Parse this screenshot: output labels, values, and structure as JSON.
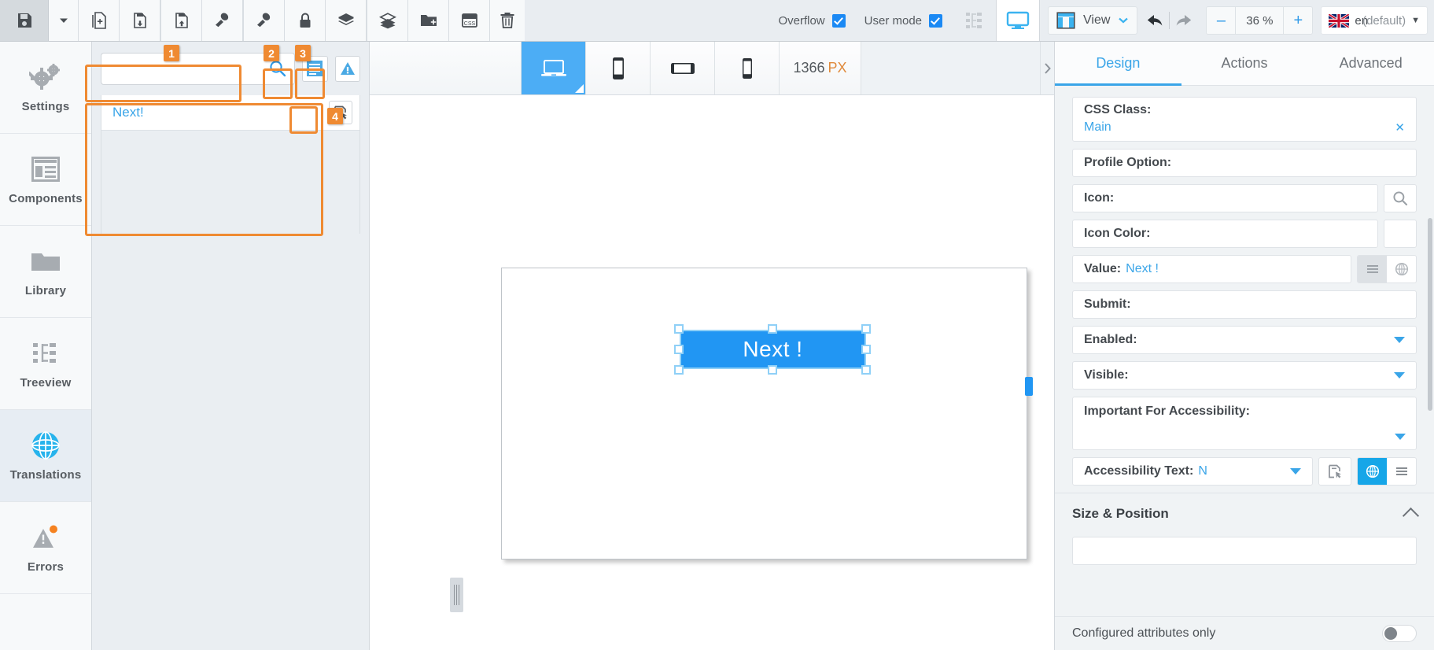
{
  "toolbar": {
    "buttons": [
      {
        "name": "save-button",
        "icon": "save-icon"
      },
      {
        "name": "save-dropdown-button",
        "icon": "caret-down-icon"
      },
      {
        "name": "new-page-button",
        "icon": "new-page-icon"
      },
      {
        "name": "import-button",
        "icon": "page-upload-icon"
      },
      {
        "name": "export-button",
        "icon": "page-download-icon"
      },
      {
        "name": "undo-paint-button",
        "icon": "paint-roller-icon"
      },
      {
        "name": "redo-paint-button",
        "icon": "paint-roller-alt-icon"
      },
      {
        "name": "lock-button",
        "icon": "lock-icon"
      },
      {
        "name": "layers-down-button",
        "icon": "layers-down-icon"
      },
      {
        "name": "layers-up-button",
        "icon": "layers-up-icon"
      },
      {
        "name": "new-folder-button",
        "icon": "folder-plus-icon"
      },
      {
        "name": "css-button",
        "icon": "css-icon"
      },
      {
        "name": "delete-button",
        "icon": "trash-icon"
      }
    ],
    "overflow_label": "Overflow",
    "overflow_checked": true,
    "user_mode_label": "User mode",
    "user_mode_checked": true,
    "tree_toggle_icon": "treeview-icon",
    "monitor_icon": "monitor-icon",
    "view_label": "View",
    "undo_icon": "undo-arrow-icon",
    "redo_icon": "redo-arrow-icon",
    "zoom_minus": "–",
    "zoom_value": "36 %",
    "zoom_plus": "+",
    "language_code": "en",
    "language_default": "(default)"
  },
  "rail": {
    "items": [
      {
        "label": "Settings",
        "icon": "gears-icon",
        "active": false
      },
      {
        "label": "Components",
        "icon": "components-icon",
        "active": false
      },
      {
        "label": "Library",
        "icon": "folder-icon",
        "active": false
      },
      {
        "label": "Treeview",
        "icon": "treeview-icon",
        "active": false
      },
      {
        "label": "Translations",
        "icon": "globe-icon",
        "active": true
      },
      {
        "label": "Errors",
        "icon": "warning-triangle-icon",
        "active": false
      }
    ]
  },
  "translations_panel": {
    "search_placeholder": "",
    "search_value": "",
    "search_icon": "search-icon",
    "list_button_icon": "list-lines-icon",
    "warning_button_icon": "warning-triangle-icon",
    "rows": [
      {
        "label": "Next!",
        "action_icon": "assign-translation-icon"
      }
    ]
  },
  "annotations": [
    {
      "number": "1",
      "target": "search-box"
    },
    {
      "number": "2",
      "target": "list-button"
    },
    {
      "number": "3",
      "target": "warning-button"
    },
    {
      "number": "4",
      "target": "translations-list"
    }
  ],
  "device_bar": {
    "devices": [
      {
        "name": "device-desktop",
        "icon": "laptop-icon",
        "active": true
      },
      {
        "name": "device-phone-portrait",
        "icon": "phone-icon",
        "active": false
      },
      {
        "name": "device-phone-landscape",
        "icon": "phone-landscape-icon",
        "active": false
      },
      {
        "name": "device-phone-small",
        "icon": "phone-small-icon",
        "active": false
      }
    ],
    "width_value": "1366",
    "width_unit": "PX",
    "collapse_icon": "chevron-right-icon"
  },
  "canvas": {
    "selected_element_label": "Next !",
    "selected_element_color": "#2196f3",
    "selection_handle_color": "#8fd0f7"
  },
  "properties_panel": {
    "tabs": [
      {
        "label": "Design",
        "active": true
      },
      {
        "label": "Actions",
        "active": false
      },
      {
        "label": "Advanced",
        "active": false
      }
    ],
    "fields": [
      {
        "label": "CSS Class:",
        "value": "Main",
        "type": "two-line-clear"
      },
      {
        "label": "Profile Option:",
        "value": "",
        "type": "plain"
      },
      {
        "label": "Icon:",
        "value": "",
        "type": "with-search"
      },
      {
        "label": "Icon Color:",
        "value": "",
        "type": "with-swatch"
      },
      {
        "label": "Value:",
        "value": "Next !",
        "type": "with-segmented"
      },
      {
        "label": "Submit:",
        "value": "",
        "type": "plain"
      },
      {
        "label": "Enabled:",
        "value": "",
        "type": "dropdown"
      },
      {
        "label": "Visible:",
        "value": "",
        "type": "dropdown"
      },
      {
        "label": "Important For Accessibility:",
        "value": "",
        "type": "tall-dropdown"
      },
      {
        "label": "Accessibility Text:",
        "value": "N",
        "type": "accessibility-row"
      }
    ],
    "segmented_icons": [
      "list-lines-icon",
      "globe-icon"
    ],
    "accessibility_buttons": [
      "assign-translation-icon",
      "globe-icon",
      "list-lines-icon"
    ],
    "section_title": "Size & Position",
    "section_collapse_icon": "chevron-up-icon",
    "footer_label": "Configured attributes only",
    "footer_toggle_on": false
  },
  "colors": {
    "accent_blue": "#3aa5e8",
    "primary_blue": "#2196f3",
    "annotation_orange": "#ef8a32",
    "panel_bg": "#f0f3f5",
    "toolbar_bg": "#e9edf1"
  }
}
